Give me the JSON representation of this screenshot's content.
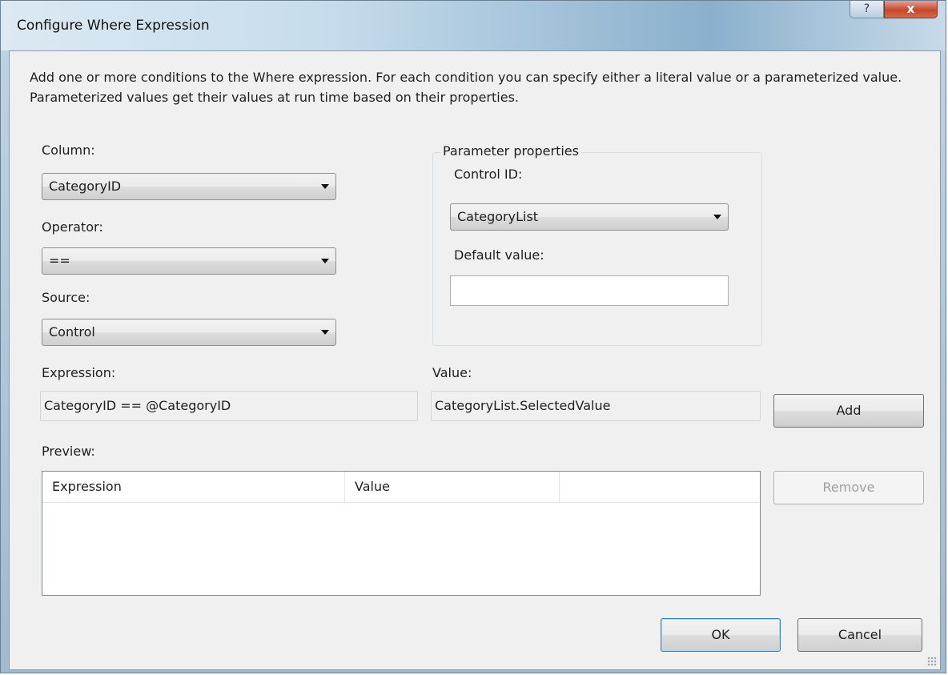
{
  "window": {
    "title": "Configure Where Expression",
    "help_glyph": "?",
    "close_glyph": "x"
  },
  "description": "Add one or more conditions to the Where expression. For each condition you can specify either a literal value or a parameterized value. Parameterized values get their values at run time based on their properties.",
  "column": {
    "label": "Column:",
    "value": "CategoryID"
  },
  "operator": {
    "label": "Operator:",
    "value": "=="
  },
  "source": {
    "label": "Source:",
    "value": "Control"
  },
  "parameter_properties": {
    "legend": "Parameter properties",
    "control_id_label": "Control ID:",
    "control_id_value": "CategoryList",
    "default_value_label": "Default value:",
    "default_value": ""
  },
  "expression": {
    "label": "Expression:",
    "value": "CategoryID == @CategoryID"
  },
  "value": {
    "label": "Value:",
    "value": "CategoryList.SelectedValue"
  },
  "buttons": {
    "add": "Add",
    "remove": "Remove",
    "ok": "OK",
    "cancel": "Cancel"
  },
  "preview": {
    "label": "Preview:",
    "columns": [
      "Expression",
      "Value",
      ""
    ],
    "rows": []
  },
  "icons": {
    "dropdown": "chevron-down-icon",
    "help": "help-icon",
    "close": "close-icon",
    "resize": "resize-grip-icon"
  }
}
